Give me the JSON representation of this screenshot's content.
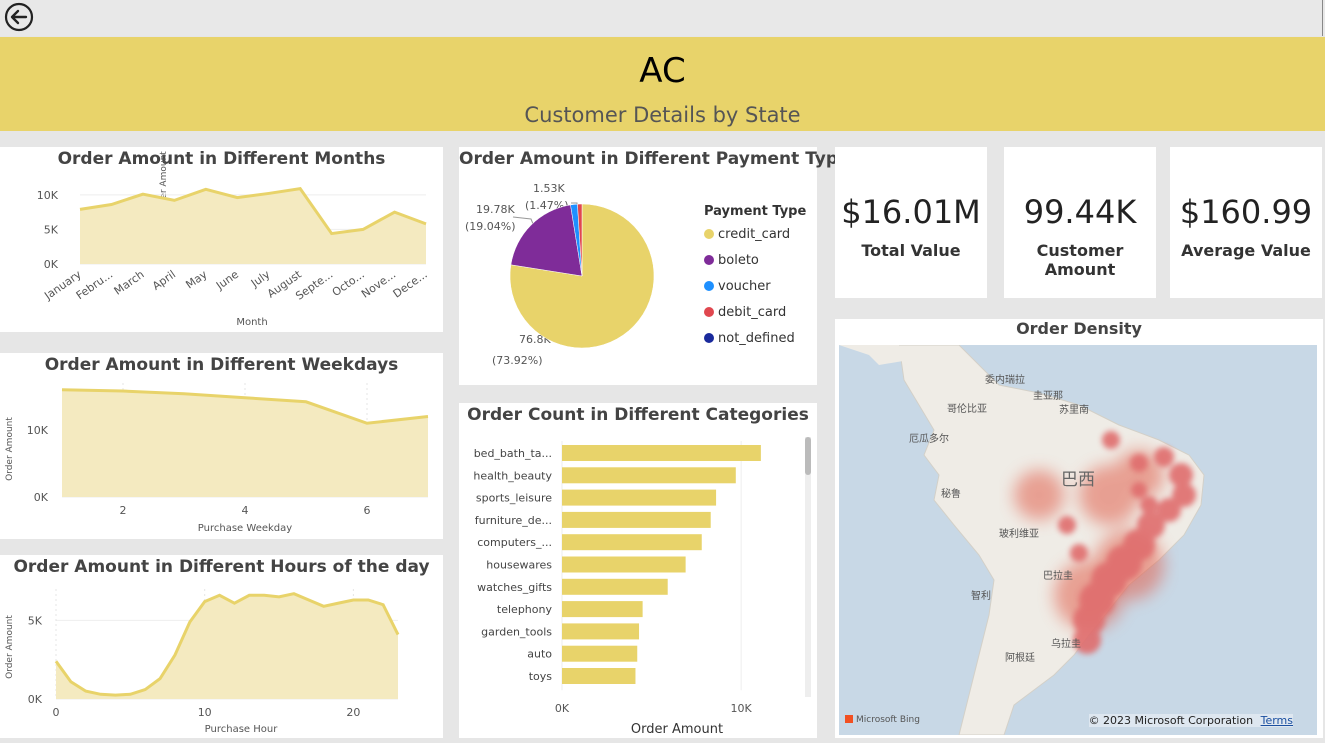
{
  "header": {
    "title": "AC",
    "subtitle": "Customer Details by State"
  },
  "months_chart": {
    "title": "Order Amount in Different Months",
    "xlabel": "Month",
    "ylabel": "Order Amount",
    "tick_labels": [
      "0K",
      "5K",
      "10K"
    ],
    "categories": [
      "January",
      "Febru...",
      "March",
      "April",
      "May",
      "June",
      "July",
      "August",
      "Septe...",
      "Octo...",
      "Nove...",
      "Dece..."
    ]
  },
  "weekdays_chart": {
    "title": "Order Amount in Different Weekdays",
    "xlabel": "Purchase Weekday",
    "ylabel": "Order Amount",
    "y_ticks": [
      "0K",
      "10K"
    ],
    "x_ticks": [
      "2",
      "4",
      "6"
    ]
  },
  "hours_chart": {
    "title": "Order Amount in Different Hours of the day",
    "xlabel": "Purchase Hour",
    "ylabel": "Order Amount",
    "y_ticks": [
      "0K",
      "5K"
    ],
    "x_ticks": [
      "0",
      "10",
      "20"
    ]
  },
  "payment_chart": {
    "title": "Order Amount in Different Payment Type",
    "legend_title": "Payment Type",
    "labels": {
      "credit_card": [
        "76.8K",
        "(73.92%)"
      ],
      "boleto": [
        "19.78K",
        "(19.04%)"
      ],
      "voucher": [
        "1.53K",
        "(1.47%)"
      ]
    }
  },
  "categories_chart": {
    "title": "Order Count in Different Categories",
    "xlabel": "Order Amount",
    "x_ticks": [
      "0K",
      "10K"
    ]
  },
  "kpis": {
    "total_value": {
      "value": "$16.01M",
      "label": "Total Value"
    },
    "customer_amount": {
      "value": "99.44K",
      "label": "Customer Amount"
    },
    "average_value": {
      "value": "$160.99",
      "label": "Average Value"
    }
  },
  "map": {
    "title": "Order Density",
    "copyright": "© 2023 Microsoft Corporation",
    "terms": "Terms",
    "bing": "Microsoft Bing",
    "place_labels": [
      "委内瑞拉",
      "圭亚那",
      "苏里南",
      "哥伦比亚",
      "厄瓜多尔",
      "巴西",
      "秘鲁",
      "玻利维亚",
      "巴拉圭",
      "智利",
      "阿根廷",
      "乌拉圭"
    ]
  },
  "chart_data": [
    {
      "type": "area",
      "title": "Order Amount in Different Months",
      "xlabel": "Month",
      "ylabel": "Order Amount",
      "categories": [
        "January",
        "Febru...",
        "March",
        "April",
        "May",
        "June",
        "July",
        "August",
        "Septe...",
        "Octo...",
        "Nove...",
        "Dece..."
      ],
      "values": [
        7900,
        8600,
        10100,
        9200,
        10800,
        9600,
        10200,
        10900,
        4400,
        5000,
        7500,
        5800
      ],
      "ylim": [
        0,
        12000
      ],
      "color": "#e8d36a"
    },
    {
      "type": "area",
      "title": "Order Amount in Different Weekdays",
      "xlabel": "Purchase Weekday",
      "ylabel": "Order Amount",
      "x": [
        1,
        2,
        3,
        4,
        5,
        6,
        7
      ],
      "values": [
        16000,
        15800,
        15400,
        14800,
        14200,
        11000,
        12000
      ],
      "ylim": [
        0,
        17000
      ],
      "color": "#e8d36a"
    },
    {
      "type": "area",
      "title": "Order Amount in Different Hours of the day",
      "xlabel": "Purchase Hour",
      "ylabel": "Order Amount",
      "x": [
        0,
        1,
        2,
        3,
        4,
        5,
        6,
        7,
        8,
        9,
        10,
        11,
        12,
        13,
        14,
        15,
        16,
        17,
        18,
        19,
        20,
        21,
        22,
        23
      ],
      "values": [
        2400,
        1100,
        500,
        300,
        250,
        300,
        600,
        1300,
        2800,
        4900,
        6200,
        6600,
        6100,
        6600,
        6600,
        6500,
        6700,
        6300,
        5900,
        6100,
        6300,
        6300,
        6000,
        4100
      ],
      "ylim": [
        0,
        7000
      ],
      "color": "#e8d36a"
    },
    {
      "type": "pie",
      "title": "Order Amount in Different Payment Type",
      "legend_title": "Payment Type",
      "labels": [
        "credit_card",
        "boleto",
        "voucher",
        "debit_card",
        "not_defined"
      ],
      "values": [
        76800,
        19780,
        1530,
        1000,
        0
      ],
      "colors": [
        "#e8d36a",
        "#7f2c99",
        "#1e90ff",
        "#e0474f",
        "#1a2a9c"
      ]
    },
    {
      "type": "bar",
      "orientation": "horizontal",
      "title": "Order Count in Different Categories",
      "xlabel": "Order Amount",
      "categories": [
        "bed_bath_ta...",
        "health_beauty",
        "sports_leisure",
        "furniture_de...",
        "computers_...",
        "housewares",
        "watches_gifts",
        "telephony",
        "garden_tools",
        "auto",
        "toys"
      ],
      "values": [
        11100,
        9700,
        8600,
        8300,
        7800,
        6900,
        5900,
        4500,
        4300,
        4200,
        4100
      ],
      "xlim": [
        0,
        12000
      ],
      "color": "#e8d36a"
    }
  ]
}
